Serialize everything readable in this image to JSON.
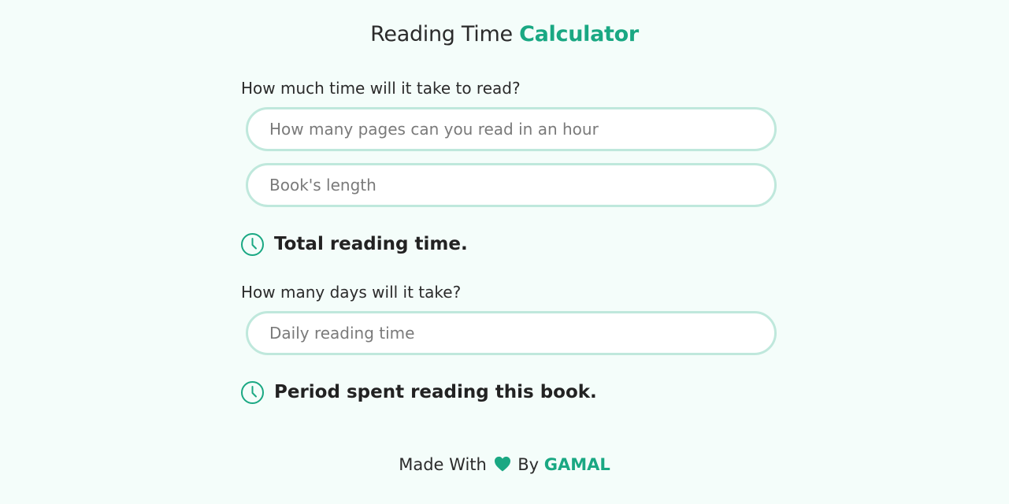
{
  "header": {
    "title_prefix": "Reading Time",
    "title_accent": "Calculator"
  },
  "reading_time_section": {
    "label": "How much time will it take to read?",
    "pages_per_hour_placeholder": "How many pages can you read in an hour",
    "book_length_placeholder": "Book's length",
    "result_text": "Total reading time."
  },
  "days_section": {
    "label": "How many days will it take?",
    "daily_time_placeholder": "Daily reading time",
    "result_text": "Period spent reading this book."
  },
  "footer": {
    "made_with": "Made With",
    "by": "By",
    "author": "GAMAL"
  },
  "colors": {
    "accent": "#1aa883",
    "background": "#f4fdfa",
    "input_border": "#bfe8dc"
  },
  "icons": {
    "result": "clock-icon",
    "footer": "heart-icon"
  }
}
